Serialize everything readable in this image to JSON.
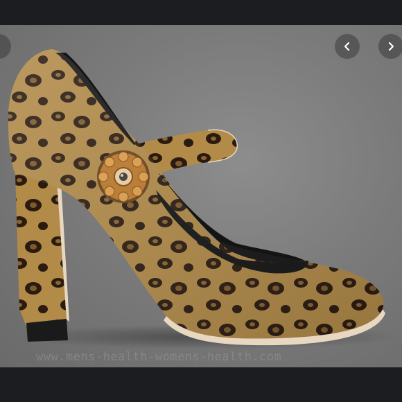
{
  "viewer": {
    "image": {
      "subject": "leopard-print velvet mary jane block heel pump with jeweled brooch button",
      "colors": {
        "background": "#7b7b7b",
        "fur_base": "#b08a4a",
        "spots": "#2b1a10",
        "lining": "#141414",
        "heel_edge": "#e8d7c1"
      }
    },
    "watermark": "www.mens-health-womens-health.com",
    "controls": {
      "prev_icon": "chevron-left-icon",
      "next_icon": "chevron-right-icon"
    }
  }
}
